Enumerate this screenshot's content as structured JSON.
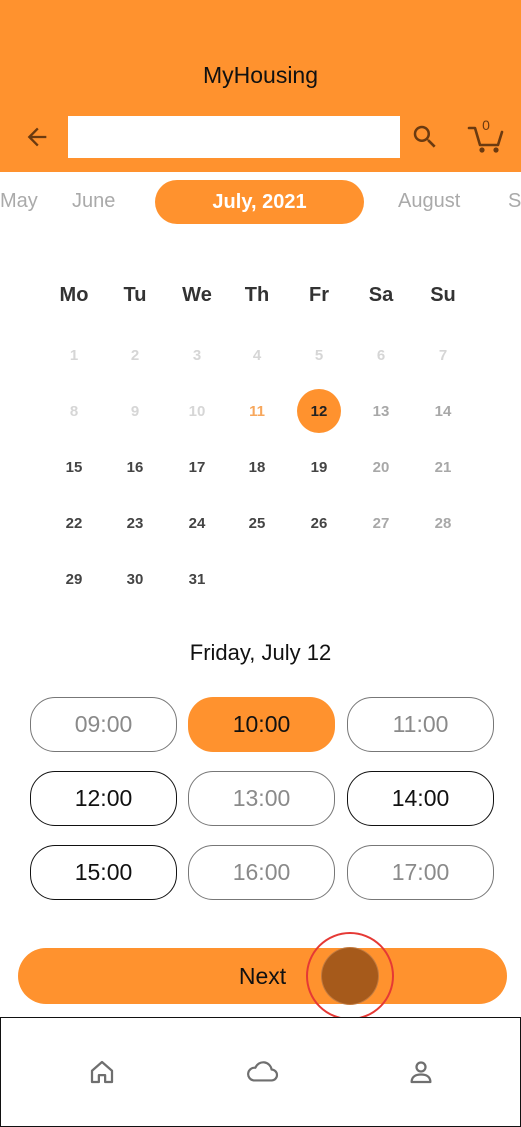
{
  "header": {
    "title": "MyHousing",
    "search": {
      "value": "",
      "placeholder": ""
    },
    "cart_count": "0",
    "colors": {
      "bar": "#FF922E",
      "icons": "#6b3a10"
    },
    "icons": {
      "back": "arrow-left-icon",
      "search": "search-icon",
      "cart": "cart-icon"
    }
  },
  "months": {
    "items": [
      "May",
      "June",
      "July, 2021",
      "August",
      "S"
    ],
    "selected": "July, 2021"
  },
  "calendar": {
    "weekdays": [
      "Mo",
      "Tu",
      "We",
      "Th",
      "Fr",
      "Sa",
      "Su"
    ],
    "weeks": [
      [
        {
          "day": "1",
          "state": "disabled"
        },
        {
          "day": "2",
          "state": "disabled"
        },
        {
          "day": "3",
          "state": "disabled"
        },
        {
          "day": "4",
          "state": "disabled"
        },
        {
          "day": "5",
          "state": "disabled"
        },
        {
          "day": "6",
          "state": "disabled"
        },
        {
          "day": "7",
          "state": "disabled"
        }
      ],
      [
        {
          "day": "8",
          "state": "disabled"
        },
        {
          "day": "9",
          "state": "disabled"
        },
        {
          "day": "10",
          "state": "disabled"
        },
        {
          "day": "11",
          "state": "today"
        },
        {
          "day": "12",
          "state": "selected"
        },
        {
          "day": "13",
          "state": "weekend"
        },
        {
          "day": "14",
          "state": "weekend"
        }
      ],
      [
        {
          "day": "15",
          "state": "avail"
        },
        {
          "day": "16",
          "state": "avail"
        },
        {
          "day": "17",
          "state": "avail"
        },
        {
          "day": "18",
          "state": "avail"
        },
        {
          "day": "19",
          "state": "avail"
        },
        {
          "day": "20",
          "state": "weekend"
        },
        {
          "day": "21",
          "state": "weekend"
        }
      ],
      [
        {
          "day": "22",
          "state": "avail"
        },
        {
          "day": "23",
          "state": "avail"
        },
        {
          "day": "24",
          "state": "avail"
        },
        {
          "day": "25",
          "state": "avail"
        },
        {
          "day": "26",
          "state": "avail"
        },
        {
          "day": "27",
          "state": "weekend"
        },
        {
          "day": "28",
          "state": "weekend"
        }
      ],
      [
        {
          "day": "29",
          "state": "avail"
        },
        {
          "day": "30",
          "state": "avail"
        },
        {
          "day": "31",
          "state": "avail"
        }
      ]
    ],
    "selected_color": "#FF922E",
    "today_color": "#F7A75C"
  },
  "selected_date_label": "Friday, July 12",
  "time_slots": [
    {
      "time": "09:00",
      "state": "disabled"
    },
    {
      "time": "10:00",
      "state": "selected"
    },
    {
      "time": "11:00",
      "state": "disabled"
    },
    {
      "time": "12:00",
      "state": "available"
    },
    {
      "time": "13:00",
      "state": "disabled"
    },
    {
      "time": "14:00",
      "state": "available"
    },
    {
      "time": "15:00",
      "state": "available"
    },
    {
      "time": "16:00",
      "state": "disabled"
    },
    {
      "time": "17:00",
      "state": "disabled"
    }
  ],
  "next_button": {
    "label": "Next"
  },
  "bottom_nav": {
    "items": [
      {
        "icon": "home-icon"
      },
      {
        "icon": "cloud-icon"
      },
      {
        "icon": "user-icon"
      }
    ]
  }
}
